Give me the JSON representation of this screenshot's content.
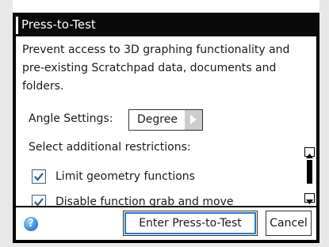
{
  "dialog": {
    "title": "Press-to-Test",
    "description": "Prevent access to 3D graphing functionality and pre-existing Scratchpad data, documents and folders.",
    "angle_label": "Angle Settings:",
    "angle_value": "Degree",
    "restrictions_label": "Select additional restrictions:",
    "restrictions": [
      {
        "label": "Limit geometry functions",
        "checked": true
      },
      {
        "label": "Disable function grab and move",
        "checked": true
      }
    ],
    "enter_button": "Enter Press-to-Test",
    "cancel_button": "Cancel",
    "help_icon": "?"
  },
  "colors": {
    "accent": "#2c77c9",
    "checkbox_check": "#2c5f93",
    "title_bar": "#0a0a0a"
  }
}
